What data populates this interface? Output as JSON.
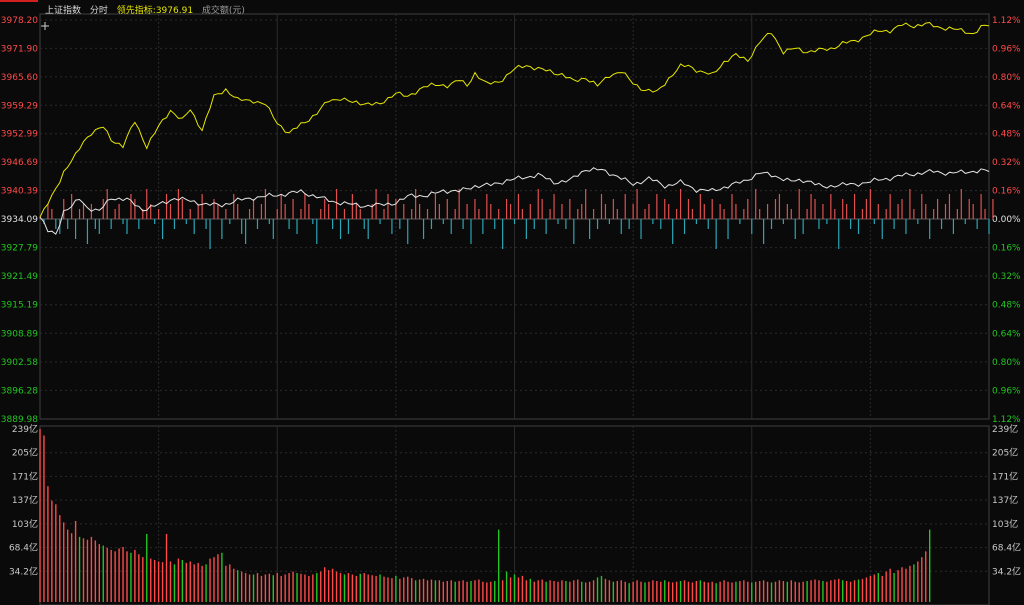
{
  "header": {
    "index_name": "上证指数",
    "tab_label": "分时",
    "leading_label": "领先指标:",
    "leading_value": "3976.91",
    "volume_label": "成交额(元)"
  },
  "colors": {
    "up": "#ff4a4a",
    "down": "#22c522",
    "price_line": "#e6e6e6",
    "leading_line": "#e6e600",
    "pos_bar": "#e05050",
    "neg_bar": "#2aa6b6",
    "grid": "#2a2a2a",
    "frame": "#404040"
  },
  "icons": {
    "crosshair": "plus-icon"
  },
  "price_axis": {
    "up_ticks": [
      "3978.20",
      "3971.90",
      "3965.60",
      "3959.29",
      "3952.99",
      "3946.69",
      "3940.39"
    ],
    "base": "3934.09",
    "down_ticks": [
      "3927.79",
      "3921.49",
      "3915.19",
      "3908.89",
      "3902.58",
      "3896.28",
      "3889.98"
    ],
    "pct_up": [
      "1.12%",
      "0.96%",
      "0.80%",
      "0.64%",
      "0.48%",
      "0.32%",
      "0.16%"
    ],
    "pct_base": "0.00%",
    "pct_down": [
      "0.16%",
      "0.32%",
      "0.48%",
      "0.64%",
      "0.80%",
      "0.96%",
      "1.12%"
    ]
  },
  "volume_axis": {
    "ticks": [
      "239亿",
      "205亿",
      "171亿",
      "137亿",
      "103亿",
      "68.4亿",
      "34.2亿"
    ]
  },
  "chart_data": {
    "type": "line",
    "base": 3934.09,
    "ylim": [
      3889.98,
      3978.2
    ],
    "points_count": 241,
    "series": [
      {
        "name": "",
        "color": "#e6e600",
        "keys": [
          [
            0,
            3934.6
          ],
          [
            1,
            3936.0
          ],
          [
            3,
            3939.2
          ],
          [
            6,
            3944.6
          ],
          [
            9,
            3948.2
          ],
          [
            11,
            3951.4
          ],
          [
            13,
            3953.3
          ],
          [
            16,
            3954.5
          ],
          [
            18,
            3951.8
          ],
          [
            21,
            3950.3
          ],
          [
            24,
            3955.8
          ],
          [
            27,
            3950.2
          ],
          [
            30,
            3954.6
          ],
          [
            33,
            3958.3
          ],
          [
            36,
            3956.0
          ],
          [
            38,
            3958.4
          ],
          [
            41,
            3953.9
          ],
          [
            44,
            3961.2
          ],
          [
            47,
            3962.9
          ],
          [
            50,
            3960.5
          ],
          [
            54,
            3960.4
          ],
          [
            57,
            3959.5
          ],
          [
            60,
            3955.5
          ],
          [
            63,
            3953.1
          ],
          [
            66,
            3955.1
          ],
          [
            70,
            3957.5
          ],
          [
            73,
            3960.4
          ],
          [
            76,
            3960.9
          ],
          [
            79,
            3959.9
          ],
          [
            83,
            3959.8
          ],
          [
            86,
            3959.4
          ],
          [
            90,
            3962.3
          ],
          [
            93,
            3961.0
          ],
          [
            97,
            3963.6
          ],
          [
            100,
            3963.7
          ],
          [
            103,
            3963.8
          ],
          [
            106,
            3964.9
          ],
          [
            108,
            3963.6
          ],
          [
            110,
            3966.5
          ],
          [
            113,
            3964.0
          ],
          [
            116,
            3964.5
          ],
          [
            120,
            3967.3
          ],
          [
            123,
            3968.2
          ],
          [
            126,
            3967.4
          ],
          [
            129,
            3966.8
          ],
          [
            132,
            3966.2
          ],
          [
            135,
            3964.6
          ],
          [
            138,
            3965.5
          ],
          [
            141,
            3963.6
          ],
          [
            144,
            3966.0
          ],
          [
            147,
            3966.8
          ],
          [
            150,
            3964.2
          ],
          [
            153,
            3962.7
          ],
          [
            156,
            3962.2
          ],
          [
            159,
            3965.3
          ],
          [
            162,
            3967.9
          ],
          [
            164,
            3968.1
          ],
          [
            167,
            3966.8
          ],
          [
            170,
            3966.0
          ],
          [
            173,
            3969.0
          ],
          [
            176,
            3970.4
          ],
          [
            179,
            3969.3
          ],
          [
            182,
            3973.3
          ],
          [
            185,
            3975.5
          ],
          [
            188,
            3971.1
          ],
          [
            191,
            3971.9
          ],
          [
            194,
            3971.2
          ],
          [
            197,
            3971.5
          ],
          [
            200,
            3971.9
          ],
          [
            203,
            3973.0
          ],
          [
            206,
            3973.5
          ],
          [
            209,
            3974.8
          ],
          [
            212,
            3975.7
          ],
          [
            215,
            3975.9
          ],
          [
            218,
            3977.1
          ],
          [
            221,
            3976.9
          ],
          [
            224,
            3977.4
          ],
          [
            227,
            3976.6
          ],
          [
            230,
            3976.4
          ],
          [
            233,
            3975.8
          ],
          [
            236,
            3975.2
          ],
          [
            238,
            3976.6
          ],
          [
            240,
            3976.9
          ]
        ]
      },
      {
        "name": "",
        "color": "#e6e6e6",
        "keys": [
          [
            0,
            3934.6
          ],
          [
            2,
            3931.5
          ],
          [
            4,
            3930.9
          ],
          [
            6,
            3935.9
          ],
          [
            8,
            3936.9
          ],
          [
            10,
            3938.7
          ],
          [
            12,
            3936.7
          ],
          [
            15,
            3935.9
          ],
          [
            18,
            3938.9
          ],
          [
            22,
            3938.5
          ],
          [
            26,
            3936.3
          ],
          [
            30,
            3937.3
          ],
          [
            34,
            3938.8
          ],
          [
            38,
            3938.2
          ],
          [
            42,
            3937.4
          ],
          [
            46,
            3937.3
          ],
          [
            50,
            3938.3
          ],
          [
            54,
            3938.9
          ],
          [
            58,
            3939.3
          ],
          [
            62,
            3939.7
          ],
          [
            66,
            3940.3
          ],
          [
            70,
            3939.1
          ],
          [
            74,
            3938.1
          ],
          [
            78,
            3937.5
          ],
          [
            82,
            3937.1
          ],
          [
            86,
            3937.3
          ],
          [
            90,
            3937.8
          ],
          [
            94,
            3939.5
          ],
          [
            98,
            3939.3
          ],
          [
            102,
            3940.5
          ],
          [
            106,
            3940.3
          ],
          [
            110,
            3941.5
          ],
          [
            114,
            3941.7
          ],
          [
            118,
            3942.7
          ],
          [
            122,
            3943.3
          ],
          [
            126,
            3944.0
          ],
          [
            130,
            3942.3
          ],
          [
            134,
            3942.7
          ],
          [
            138,
            3945.2
          ],
          [
            142,
            3945.0
          ],
          [
            146,
            3943.7
          ],
          [
            150,
            3941.8
          ],
          [
            154,
            3943.2
          ],
          [
            158,
            3941.5
          ],
          [
            162,
            3942.3
          ],
          [
            166,
            3940.7
          ],
          [
            170,
            3940.4
          ],
          [
            174,
            3941.5
          ],
          [
            178,
            3942.5
          ],
          [
            182,
            3944.4
          ],
          [
            186,
            3943.7
          ],
          [
            190,
            3942.5
          ],
          [
            194,
            3942.8
          ],
          [
            198,
            3941.2
          ],
          [
            202,
            3941.8
          ],
          [
            206,
            3941.8
          ],
          [
            210,
            3942.5
          ],
          [
            214,
            3943.1
          ],
          [
            218,
            3943.8
          ],
          [
            222,
            3944.3
          ],
          [
            226,
            3944.7
          ],
          [
            230,
            3944.3
          ],
          [
            234,
            3944.6
          ],
          [
            238,
            3944.9
          ],
          [
            240,
            3944.7
          ]
        ]
      }
    ],
    "strength_bars": {
      "color_pos": "#e05050",
      "color_neg": "#2aa6b6",
      "values": [
        0.5,
        -1,
        3,
        2,
        -2,
        -3,
        4,
        -2,
        5,
        -4,
        2,
        3,
        -5,
        3,
        -2,
        -3,
        4,
        6,
        -2,
        2,
        3,
        -1,
        -3,
        5,
        4,
        -2,
        2,
        6,
        3,
        -1,
        2,
        -4,
        5,
        3,
        -2,
        6,
        4,
        -1,
        2,
        -3,
        3,
        5,
        -2,
        -6,
        4,
        3,
        -4,
        2,
        -1,
        5,
        3,
        -3,
        -5,
        2,
        4,
        -2,
        3,
        6,
        -1,
        -4,
        2,
        5,
        3,
        -2,
        4,
        -3,
        2,
        5,
        3,
        -1,
        -5,
        2,
        4,
        3,
        -2,
        6,
        -4,
        2,
        -3,
        5,
        3,
        2,
        -2,
        -4,
        3,
        6,
        -1,
        2,
        5,
        -3,
        4,
        -2,
        3,
        -5,
        2,
        6,
        3,
        -4,
        2,
        -2,
        5,
        3,
        -1,
        4,
        -3,
        2,
        6,
        -2,
        3,
        -5,
        4,
        2,
        -3,
        5,
        3,
        -2,
        2,
        -6,
        4,
        3,
        -1,
        5,
        2,
        -4,
        3,
        -2,
        6,
        4,
        -3,
        2,
        5,
        -1,
        3,
        -2,
        4,
        -5,
        2,
        3,
        6,
        -4,
        2,
        -2,
        5,
        3,
        -1,
        4,
        2,
        -3,
        5,
        -2,
        3,
        6,
        -4,
        2,
        3,
        -1,
        5,
        -2,
        4,
        3,
        -5,
        2,
        6,
        -3,
        4,
        2,
        -1,
        5,
        3,
        -2,
        4,
        -6,
        3,
        2,
        -4,
        5,
        3,
        -1,
        2,
        4,
        -3,
        6,
        2,
        -5,
        3,
        -2,
        4,
        5,
        -1,
        3,
        2,
        -4,
        6,
        -3,
        2,
        5,
        4,
        -2,
        3,
        -1,
        5,
        2,
        -6,
        4,
        3,
        -2,
        5,
        -3,
        2,
        4,
        6,
        -1,
        3,
        -4,
        2,
        5,
        -2,
        3,
        4,
        -3,
        6,
        2,
        -1,
        5,
        3,
        -4,
        2,
        4,
        -2,
        3,
        5,
        -3,
        2,
        6,
        -1,
        4,
        3,
        -2,
        5,
        2,
        -3,
        4
      ]
    },
    "volume": {
      "unit": "亿",
      "ylim": [
        0,
        239
      ],
      "values": [
        239,
        230,
        160,
        140,
        135,
        120,
        110,
        100,
        95,
        112,
        90,
        88,
        86,
        90,
        85,
        80,
        78,
        75,
        72,
        70,
        74,
        76,
        70,
        68,
        72,
        66,
        62,
        94,
        60,
        58,
        56,
        55,
        94,
        56,
        52,
        60,
        58,
        54,
        56,
        52,
        54,
        50,
        52,
        60,
        62,
        66,
        68,
        50,
        52,
        46,
        44,
        42,
        40,
        38,
        38,
        40,
        36,
        38,
        39,
        37,
        40,
        36,
        38,
        40,
        42,
        40,
        39,
        38,
        36,
        38,
        40,
        42,
        48,
        44,
        46,
        42,
        40,
        38,
        40,
        38,
        36,
        39,
        40,
        38,
        37,
        36,
        38,
        35,
        34,
        33,
        36,
        32,
        34,
        35,
        33,
        30,
        31,
        32,
        30,
        31,
        30,
        30,
        28,
        29,
        30,
        28,
        29,
        30,
        28,
        29,
        30,
        31,
        28,
        27,
        28,
        29,
        100,
        30,
        42,
        34,
        38,
        34,
        36,
        30,
        32,
        28,
        30,
        31,
        28,
        30,
        29,
        28,
        30,
        29,
        28,
        30,
        31,
        28,
        27,
        28,
        30,
        34,
        36,
        32,
        30,
        28,
        29,
        30,
        28,
        26,
        28,
        30,
        28,
        27,
        28,
        30,
        29,
        28,
        30,
        28,
        27,
        28,
        29,
        30,
        28,
        27,
        29,
        30,
        28,
        27,
        28,
        26,
        28,
        30,
        28,
        27,
        28,
        29,
        30,
        28,
        27,
        28,
        29,
        30,
        28,
        27,
        28,
        30,
        29,
        28,
        30,
        28,
        27,
        28,
        29,
        30,
        31,
        30,
        29,
        28,
        30,
        31,
        32,
        30,
        29,
        28,
        30,
        31,
        32,
        34,
        36,
        38,
        40,
        36,
        42,
        46,
        40,
        44,
        48,
        46,
        50,
        52,
        56,
        62,
        70,
        100
      ],
      "up_flags": [
        1,
        1,
        1,
        1,
        1,
        1,
        1,
        1,
        1,
        1,
        0,
        1,
        1,
        1,
        1,
        1,
        0,
        1,
        1,
        1,
        1,
        1,
        1,
        0,
        1,
        1,
        1,
        0,
        1,
        1,
        1,
        1,
        1,
        1,
        0,
        1,
        0,
        1,
        1,
        1,
        1,
        1,
        0,
        1,
        1,
        1,
        0,
        1,
        1,
        1,
        0,
        1,
        1,
        1,
        0,
        1,
        1,
        1,
        1,
        0,
        1,
        1,
        1,
        1,
        1,
        0,
        1,
        1,
        1,
        1,
        0,
        1,
        1,
        1,
        1,
        1,
        1,
        0,
        1,
        1,
        1,
        0,
        1,
        1,
        1,
        1,
        0,
        1,
        1,
        1,
        0,
        1,
        1,
        1,
        1,
        0,
        1,
        1,
        1,
        1,
        0,
        1,
        1,
        1,
        1,
        0,
        1,
        1,
        1,
        0,
        1,
        1,
        1,
        1,
        1,
        0,
        0,
        1,
        0,
        1,
        0,
        1,
        1,
        1,
        0,
        1,
        1,
        1,
        0,
        1,
        1,
        1,
        1,
        0,
        1,
        1,
        1,
        0,
        1,
        1,
        1,
        0,
        0,
        1,
        1,
        0,
        1,
        1,
        1,
        0,
        1,
        1,
        1,
        0,
        1,
        1,
        1,
        1,
        0,
        1,
        1,
        1,
        0,
        1,
        1,
        1,
        1,
        0,
        1,
        1,
        1,
        0,
        1,
        1,
        1,
        1,
        0,
        1,
        1,
        1,
        0,
        1,
        1,
        1,
        1,
        0,
        1,
        1,
        1,
        0,
        1,
        1,
        1,
        1,
        0,
        1,
        1,
        1,
        0,
        1,
        1,
        1,
        1,
        0,
        1,
        1,
        1,
        0,
        1,
        1,
        1,
        1,
        0,
        1,
        1,
        1,
        0,
        1,
        1,
        1,
        1,
        0,
        1,
        1,
        1,
        0,
        1,
        1,
        1,
        1,
        1,
        1,
        1,
        1,
        1,
        0
      ]
    }
  }
}
